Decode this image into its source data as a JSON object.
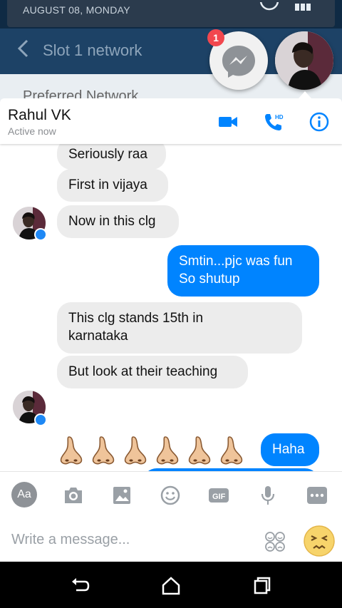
{
  "background": {
    "date": "AUGUST 08, MONDAY",
    "toolbar_title": "Slot 1 network",
    "list_item": "Preferred Network"
  },
  "chat_heads": {
    "badge_count": "1"
  },
  "header": {
    "contact_name": "Rahul VK",
    "status": "Active now"
  },
  "messages": [
    {
      "dir": "in",
      "text": "Seriously raa"
    },
    {
      "dir": "in",
      "text": "First in vijaya"
    },
    {
      "dir": "in",
      "text": "Now in this clg"
    },
    {
      "dir": "out",
      "line1": "Smtin...pjc was fun",
      "line2": "So shutup"
    },
    {
      "dir": "in",
      "line1": "This clg stands 15th in",
      "line2": "karnataka"
    },
    {
      "dir": "in",
      "text": "But look at their teaching"
    },
    {
      "dir": "in",
      "emoji_count": 6
    },
    {
      "dir": "out",
      "text": "Haha"
    }
  ],
  "composer": {
    "aa_label": "Aa",
    "placeholder": "Write a message..."
  },
  "colors": {
    "messenger_blue": "#0084ff",
    "incoming_bubble": "#ececec",
    "icon_gray": "#9aa0a6"
  }
}
